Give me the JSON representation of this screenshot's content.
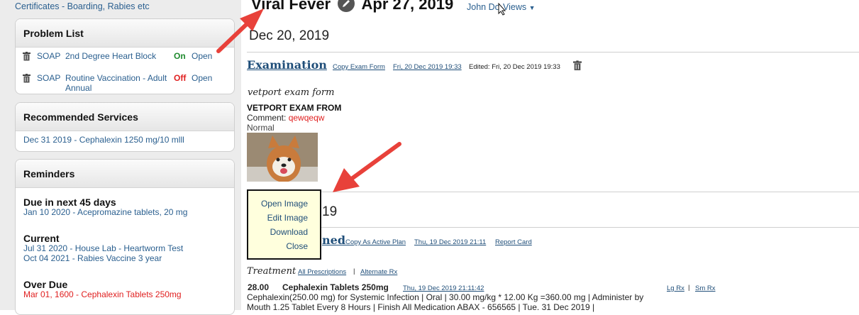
{
  "sidebar": {
    "top_link": "Certificates - Boarding, Rabies etc",
    "problem_list": {
      "title": "Problem List",
      "items": [
        {
          "type": "SOAP",
          "name": "2nd Degree Heart Block",
          "flag": "On",
          "status": "Open"
        },
        {
          "type": "SOAP",
          "name": "Routine Vaccination - Adult Annual",
          "flag": "Off",
          "status": "Open"
        }
      ]
    },
    "recommended_services": {
      "title": "Recommended Services",
      "items": [
        "Dec 31 2019 - Cephalexin 1250 mg/10 mlll"
      ]
    },
    "reminders": {
      "title": "Reminders",
      "due_next": {
        "label": "Due in next 45 days",
        "items": [
          "Jan 10 2020 - Acepromazine tablets, 20 mg"
        ]
      },
      "current": {
        "label": "Current",
        "items": [
          "Jul 31 2020 - House Lab - Heartworm Test",
          "Oct 04 2021 - Rabies Vaccine 3 year"
        ]
      },
      "overdue": {
        "label": "Over Due",
        "items": [
          "Mar 01, 1600 - Cephalexin Tablets 250mg"
        ]
      }
    }
  },
  "header": {
    "title_left": "Viral Fever",
    "title_right": "Apr 27, 2019",
    "user": "John Do",
    "views": "Views"
  },
  "main": {
    "date1": "Dec 20, 2019",
    "examination": {
      "title": "Examination",
      "copy_link": "Copy Exam Form",
      "created": "Fri, 20 Dec 2019 19:33",
      "edited": "Edited: Fri, 20 Dec 2019 19:33",
      "form_name": "vetport exam form",
      "form_heading": "VETPORT EXAM FROM",
      "comment_label": "Comment:",
      "comment_value": "qewqeqw",
      "normal": "Normal"
    },
    "date2_partial": "19",
    "plan": {
      "title_partial": "ned",
      "copy_link": "Copy As Active Plan",
      "date": "Thu, 19 Dec 2019 21:11",
      "report_card": "Report Card"
    },
    "context_menu": [
      "Open Image",
      "Edit Image",
      "Download",
      "Close"
    ],
    "treatment": {
      "label": "Treatment",
      "all_prescriptions": "All Prescriptions",
      "separator": "|",
      "alternate_rx": "Alternate Rx",
      "qty": "28.00",
      "drug": "Cephalexin Tablets 250mg",
      "drug_date": "Thu, 19 Dec 2019 21:11:42",
      "lg_rx": "Lg Rx",
      "sm_rx": "Sm Rx",
      "description": "Cephalexin(250.00 mg) for Systemic Infection | Oral | 30.00 mg/kg * 12.00 Kg =360.00 mg | Administer by Mouth 1.25 Tablet Every 8 Hours | Finish All Medication ABAX - 656565 | Tue. 31 Dec 2019 |"
    }
  },
  "colors": {
    "link": "#2a5f8f",
    "arrow": "#e8413a",
    "flag_on": "#1f8a2e",
    "flag_off": "#e02020",
    "popup_bg": "#ffffdd"
  }
}
